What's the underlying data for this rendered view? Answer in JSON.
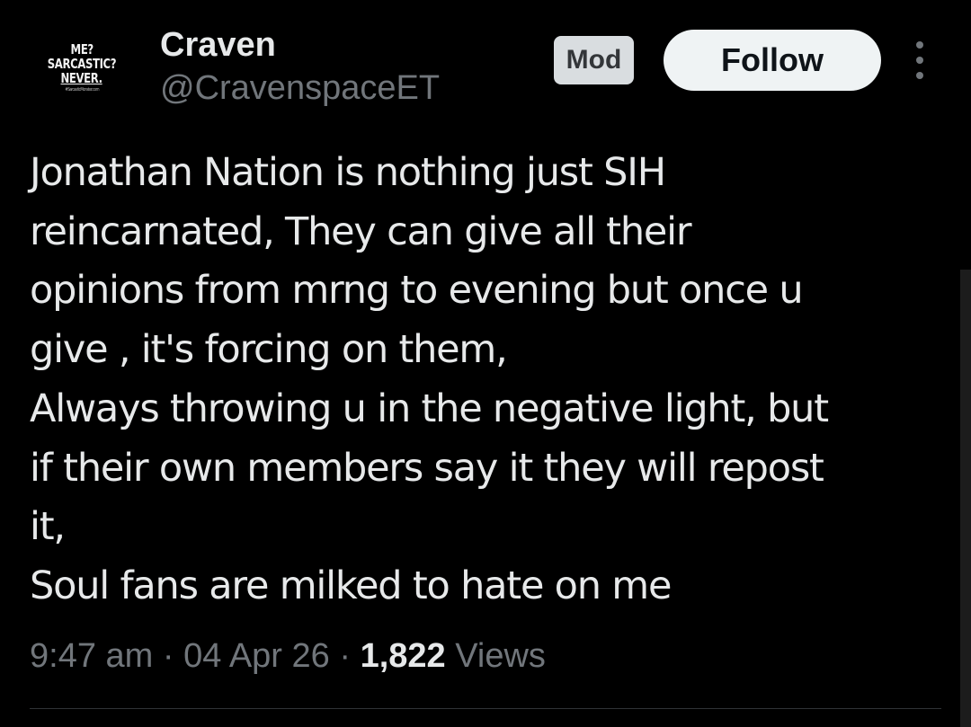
{
  "author": {
    "display_name": "Craven",
    "handle": "@CravenspaceET",
    "avatar_text": [
      "ME?",
      "SARCASTIC?",
      "NEVER.",
      "#SarcasticMonster.com"
    ]
  },
  "badge": {
    "label": "Mod"
  },
  "actions": {
    "follow_label": "Follow",
    "more_icon": "more-vertical-icon"
  },
  "tweet": {
    "lines": [
      "Jonathan Nation is nothing just SIH",
      "reincarnated, They can give all their",
      "opinions from mrng to evening but once u",
      "give , it's forcing on them,",
      "Always throwing u in the negative light, but",
      "if their own members say it they will repost",
      "it,",
      "Soul fans are milked to hate on me"
    ]
  },
  "meta": {
    "time": "9:47 am",
    "separator": "·",
    "date": "04 Apr 26",
    "views_count": "1,822",
    "views_label": "Views"
  },
  "colors": {
    "background": "#000000",
    "text_primary": "#e7e9ea",
    "text_secondary": "#71767b",
    "follow_bg": "#eff3f4",
    "badge_bg": "#d9dde0",
    "divider": "#2f3336"
  }
}
